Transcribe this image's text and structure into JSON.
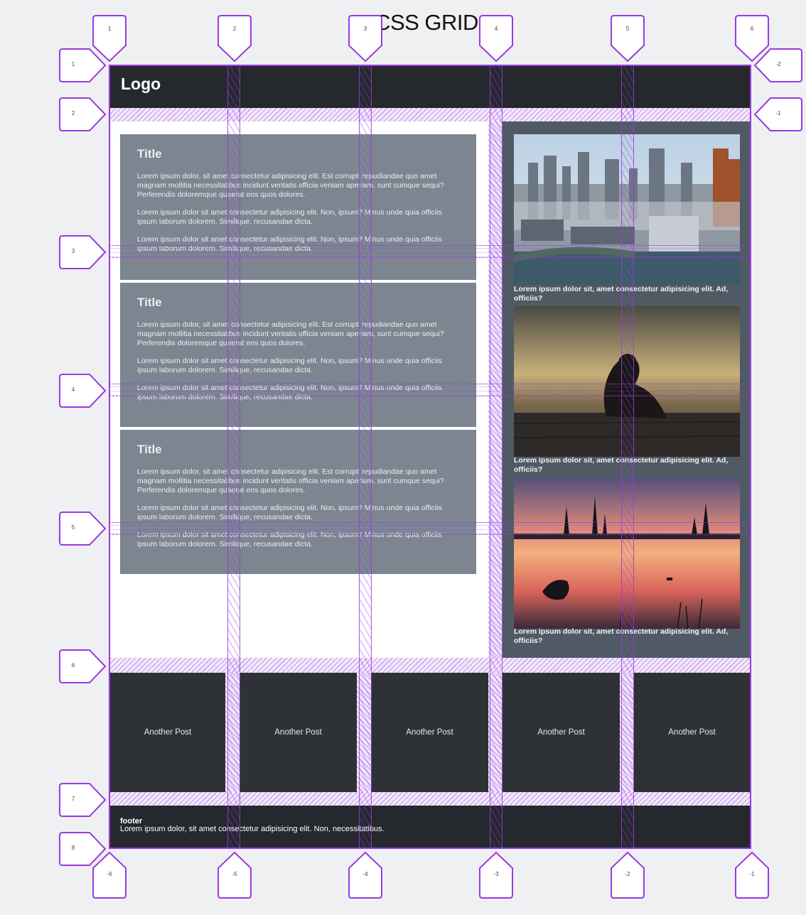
{
  "page": {
    "title": "CSS GRID"
  },
  "header": {
    "logo": "Logo"
  },
  "main": {
    "cards": [
      {
        "title": "Title",
        "paragraphs": [
          "Lorem ipsum dolor, sit amet consectetur adipisicing elit. Est corrupti repudiandae quo amet magnam mollitia necessitatibus incidunt veritatis officia veniam aperiam, sunt cumque sequi? Perferendis doloremque quaerat eos quos dolores.",
          "Lorem ipsum dolor sit amet consectetur adipisicing elit. Non, ipsum? Minus unde quia officiis ipsum laborum dolorem. Similique, recusandae dicta.",
          "Lorem ipsum dolor sit amet consectetur adipisicing elit. Non, ipsum? Minus unde quia officiis ipsum laborum dolorem. Similique, recusandae dicta."
        ]
      },
      {
        "title": "Title",
        "paragraphs": [
          "Lorem ipsum dolor, sit amet consectetur adipisicing elit. Est corrupti repudiandae quo amet magnam mollitia necessitatibus incidunt veritatis officia veniam aperiam, sunt cumque sequi? Perferendis doloremque quaerat eos quos dolores.",
          "Lorem ipsum dolor sit amet consectetur adipisicing elit. Non, ipsum? Minus unde quia officiis ipsum laborum dolorem. Similique, recusandae dicta.",
          "Lorem ipsum dolor sit amet consectetur adipisicing elit. Non, ipsum? Minus unde quia officiis ipsum laborum dolorem. Similique, recusandae dicta."
        ]
      },
      {
        "title": "Title",
        "paragraphs": [
          "Lorem ipsum dolor, sit amet consectetur adipisicing elit. Est corrupti repudiandae quo amet magnam mollitia necessitatibus incidunt veritatis officia veniam aperiam, sunt cumque sequi? Perferendis doloremque quaerat eos quos dolores.",
          "Lorem ipsum dolor sit amet consectetur adipisicing elit. Non, ipsum? Minus unde quia officiis ipsum laborum dolorem. Similique, recusandae dicta.",
          "Lorem ipsum dolor sit amet consectetur adipisicing elit. Non, ipsum? Minus unde quia officiis ipsum laborum dolorem. Similique, recusandae dicta."
        ]
      }
    ]
  },
  "sidebar": {
    "items": [
      {
        "image": "city-skyline-photo",
        "caption": "Lorem ipsum dolor sit, amet consectetur adipisicing elit. Ad, officiis?"
      },
      {
        "image": "sitting-person-sunset-photo",
        "caption": "Lorem ipsum dolor sit, amet consectetur adipisicing elit. Ad, officiis?"
      },
      {
        "image": "lake-sunset-photo",
        "caption": "Lorem ipsum dolor sit, amet consectetur adipisicing elit. Ad, officiis?"
      }
    ]
  },
  "posts": [
    "Another Post",
    "Another Post",
    "Another Post",
    "Another Post",
    "Another Post"
  ],
  "footer": {
    "title": "footer",
    "text": "Lorem ipsum dolor, sit amet consectetur adipisicing elit. Non, necessitatibus."
  },
  "grid_overlay": {
    "color": "#9a3ae0",
    "column_labels_top": [
      "1",
      "2",
      "3",
      "4",
      "5",
      "6"
    ],
    "column_labels_bottom": [
      "-6",
      "-5",
      "-4",
      "-3",
      "-2",
      "-1"
    ],
    "row_labels_left": [
      "1",
      "2",
      "3",
      "4",
      "5",
      "6",
      "7",
      "8"
    ],
    "row_labels_right": [
      "-2",
      "-1"
    ]
  }
}
